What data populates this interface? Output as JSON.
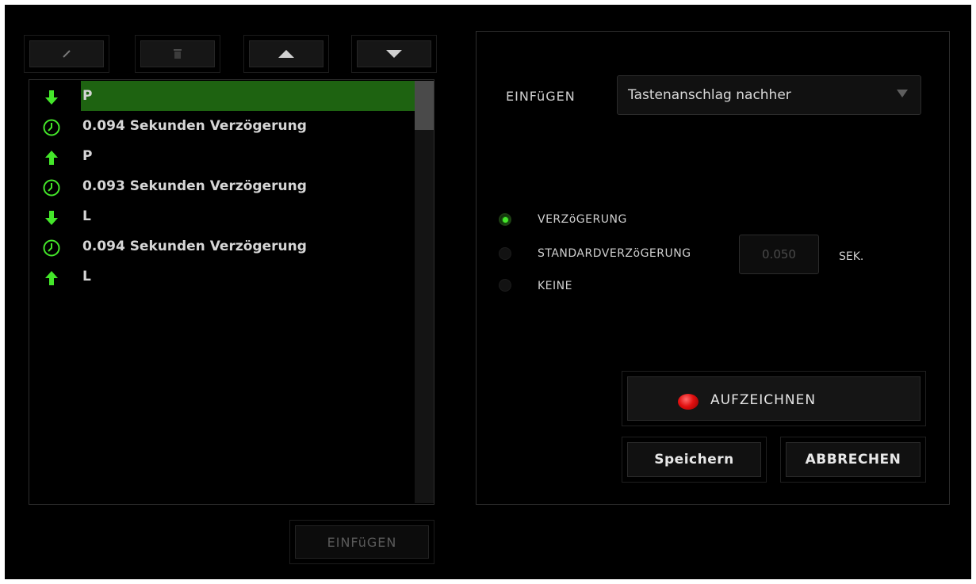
{
  "toolbar": {
    "edit_icon": "pencil-icon",
    "delete_icon": "trash-icon",
    "move_up_icon": "triangle-up-icon",
    "move_down_icon": "triangle-down-icon"
  },
  "macro_list": {
    "items": [
      {
        "type": "key-down",
        "icon": "arrow-down-icon",
        "text": "P",
        "selected": true
      },
      {
        "type": "delay",
        "icon": "clock-icon",
        "text": "0.094 Sekunden Verzögerung",
        "selected": false
      },
      {
        "type": "key-up",
        "icon": "arrow-up-icon",
        "text": "P",
        "selected": false
      },
      {
        "type": "delay",
        "icon": "clock-icon",
        "text": "0.093 Sekunden Verzögerung",
        "selected": false
      },
      {
        "type": "key-down",
        "icon": "arrow-down-icon",
        "text": "L",
        "selected": false
      },
      {
        "type": "delay",
        "icon": "clock-icon",
        "text": "0.094 Sekunden Verzögerung",
        "selected": false
      },
      {
        "type": "key-up",
        "icon": "arrow-up-icon",
        "text": "L",
        "selected": false
      }
    ]
  },
  "insert_button_label": "EINFüGEN",
  "settings": {
    "insert_label": "EINFüGEN",
    "insert_dropdown_value": "Tastenanschlag nachher",
    "delay_options": [
      {
        "label": "VERZöGERUNG",
        "selected": true
      },
      {
        "label": "STANDARDVERZöGERUNG",
        "selected": false
      },
      {
        "label": "KEINE",
        "selected": false
      }
    ],
    "default_delay_value": "0.050",
    "default_delay_unit": "SEK.",
    "record_label": "AUFZEICHNEN",
    "save_label": "Speichern",
    "cancel_label": "ABBRECHEN"
  },
  "colors": {
    "accent_green": "#44e62a",
    "selected_row": "#1e6311",
    "record_red": "#e21010"
  }
}
